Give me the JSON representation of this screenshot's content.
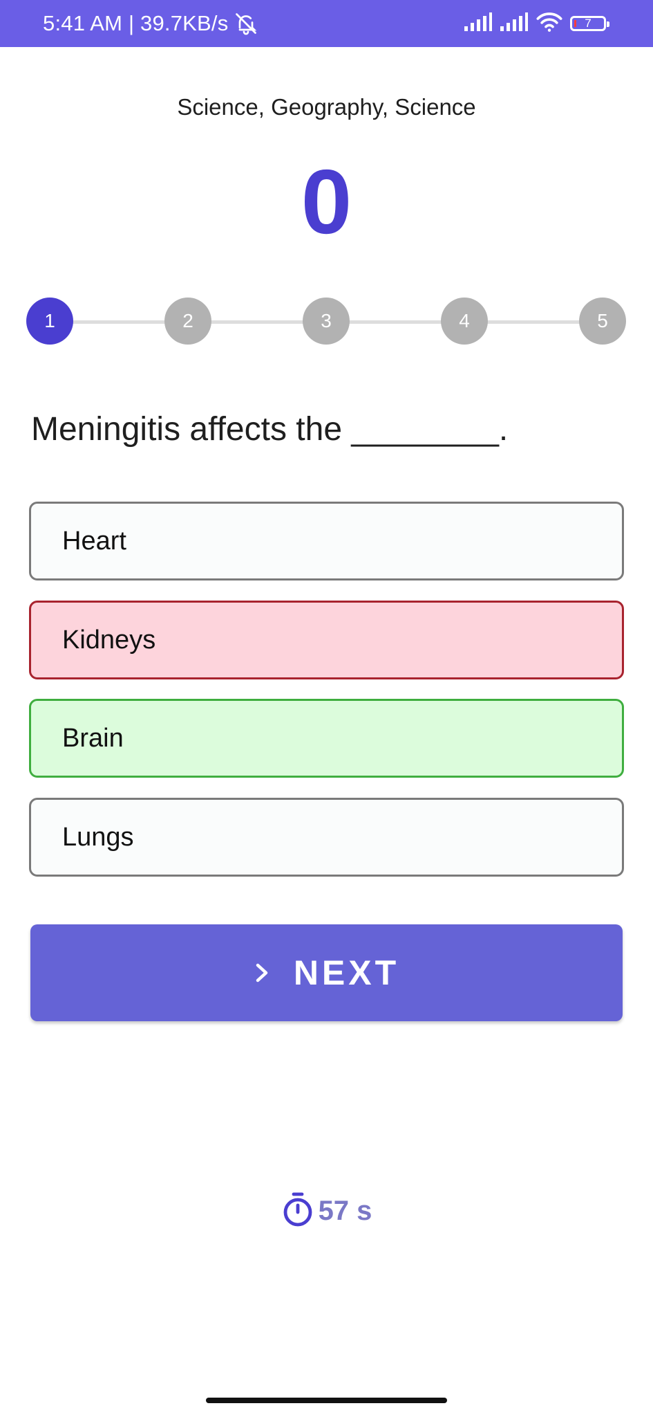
{
  "status_bar": {
    "time_speed": "5:41 AM | 39.7KB/s",
    "battery_level": "7",
    "icons": [
      "bell-off-icon",
      "signal-icon",
      "signal-icon",
      "wifi-icon",
      "battery-icon"
    ]
  },
  "quiz": {
    "categories": "Science, Geography, Science",
    "score": "0",
    "steps": [
      {
        "number": "1",
        "state": "active"
      },
      {
        "number": "2",
        "state": "inactive"
      },
      {
        "number": "3",
        "state": "inactive"
      },
      {
        "number": "4",
        "state": "inactive"
      },
      {
        "number": "5",
        "state": "inactive"
      }
    ],
    "question": "Meningitis affects the ________.",
    "options": [
      {
        "label": "Heart",
        "state": "default"
      },
      {
        "label": "Kidneys",
        "state": "wrong"
      },
      {
        "label": "Brain",
        "state": "correct"
      },
      {
        "label": "Lungs",
        "state": "default"
      }
    ],
    "next_button": {
      "label": "NEXT",
      "icon": "chevron-right-icon"
    },
    "timer": {
      "text": "57 s",
      "icon": "stopwatch-icon"
    }
  },
  "colors": {
    "status_bar": "#6a5ee6",
    "accent": "#4a3ed0",
    "button": "#6563d6",
    "wrong_bg": "#fdd4dc",
    "wrong_border": "#a8232e",
    "correct_bg": "#dcfcdc",
    "correct_border": "#3fae3f",
    "timer_text": "#7a78c6"
  }
}
